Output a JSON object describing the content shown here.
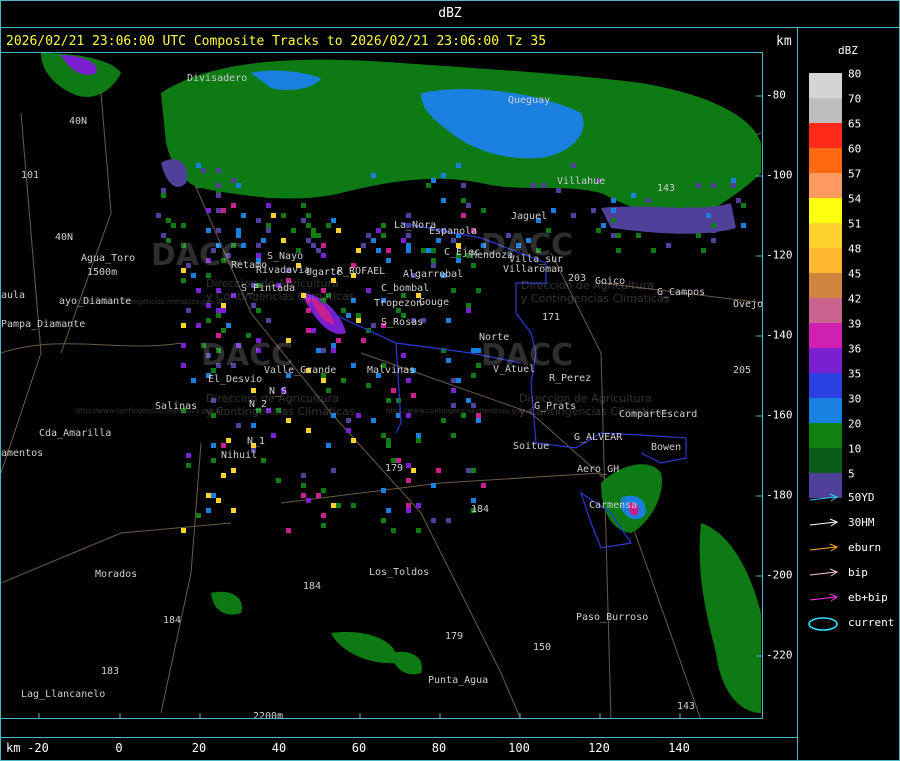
{
  "header": {
    "title": "dBZ"
  },
  "subtitle": "2026/02/21 23:06:00 UTC Composite Tracks to 2026/02/21 23:06:00 Tz 35",
  "axis_unit": "km",
  "x_ticks": [
    "-20",
    "0",
    "20",
    "40",
    "60",
    "80",
    "100",
    "120",
    "140"
  ],
  "y_ticks": [
    "-80",
    "-100",
    "-120",
    "-140",
    "-160",
    "-180",
    "-200",
    "-220"
  ],
  "scale": {
    "label": "dBZ",
    "levels": [
      {
        "v": "80",
        "c": "#d4d4d4"
      },
      {
        "v": "70",
        "c": "#bdbdbd"
      },
      {
        "v": "65",
        "c": "#ff2a1a"
      },
      {
        "v": "60",
        "c": "#ff6a10"
      },
      {
        "v": "57",
        "c": "#ff9960"
      },
      {
        "v": "54",
        "c": "#ffff10"
      },
      {
        "v": "51",
        "c": "#ffd230"
      },
      {
        "v": "48",
        "c": "#ffb830"
      },
      {
        "v": "45",
        "c": "#cd8540"
      },
      {
        "v": "42",
        "c": "#c8648e"
      },
      {
        "v": "39",
        "c": "#d020b0"
      },
      {
        "v": "36",
        "c": "#7a20d0"
      },
      {
        "v": "35",
        "c": "#2a40e0"
      },
      {
        "v": "30",
        "c": "#1a80e0"
      },
      {
        "v": "20",
        "c": "#108010"
      },
      {
        "v": "10",
        "c": "#0a5a1a"
      },
      {
        "v": "5",
        "c": "#50409a"
      }
    ]
  },
  "legend": [
    {
      "label": "50YD",
      "color": "#2ad0f0"
    },
    {
      "label": "30HM",
      "color": "#ffffff"
    },
    {
      "label": "eburn",
      "color": "#ffb020"
    },
    {
      "label": "bip",
      "color": "#ffc8e0"
    },
    {
      "label": "eb+bip",
      "color": "#ff30ff"
    },
    {
      "label": "current",
      "color": "#30e0ff"
    }
  ],
  "places": [
    "Divisadero",
    "40N",
    "101",
    "40N",
    "Agua_Toro",
    "1500m",
    "ayo_Diamante",
    "aula",
    "Pampa_Diamante",
    "Retamo",
    "S_Nayo",
    "Rivadavia",
    "Ugarte",
    "La_Nora",
    "Espanola",
    "C_Ejec",
    "Mendoza",
    "S_Pintada",
    "R_ROFAEL",
    "Algarrobal",
    "C_bombal",
    "Tropezon",
    "Gouge",
    "S_Rosas",
    "Norte",
    "Valle_Grande",
    "Malvinas",
    "El_Desvio",
    "N_S",
    "N_2",
    "Salinas",
    "Cda_Amarilla",
    "amentos",
    "N_1",
    "Nihuil",
    "Los_Toldos",
    "Morados",
    "Lag_Llancanelo",
    "2200m",
    "Punta_Agua",
    "179",
    "184",
    "179",
    "184",
    "184",
    "183",
    "150",
    "V_Atuel",
    "R_Perez",
    "G_Prats",
    "Soitue",
    "G_ALVEAR",
    "Aero_GH",
    "Bowen",
    "CompartEscard",
    "Carmensa",
    "Paso_Burroso",
    "Paso_El_Loro",
    "Goico",
    "G_Campos",
    "Ovejo",
    "143",
    "205",
    "203",
    "171",
    "Jaguel",
    "Queguay",
    "Villahue",
    "143",
    "Villaroman",
    "Villa_sur"
  ],
  "watermark": {
    "brand": "DACC",
    "line1": "Direccion de Agricultura",
    "line2": "y Contingencias Climaticas",
    "url": "http://www.contingencias.mendoza.gov.ar"
  }
}
